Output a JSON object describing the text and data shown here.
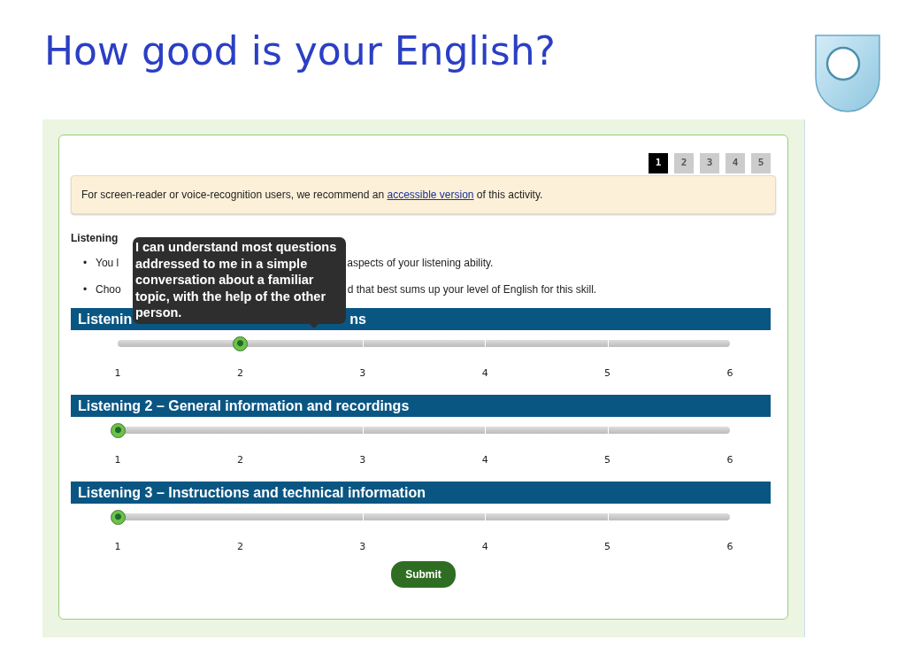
{
  "title": "How good is your English?",
  "pages": [
    {
      "label": "1",
      "selected": true
    },
    {
      "label": "2",
      "selected": false
    },
    {
      "label": "3",
      "selected": false
    },
    {
      "label": "4",
      "selected": false
    },
    {
      "label": "5",
      "selected": false
    }
  ],
  "notice": {
    "before": "For screen-reader or voice-recognition users, we recommend an",
    "link": "accessible version",
    "after": "of this activity."
  },
  "section_title": "Listening",
  "bullets": [
    {
      "marker": "•",
      "parts": [
        "You l",
        "aspects of your listening ability."
      ]
    },
    {
      "marker": "•",
      "parts": [
        "Choo",
        "d that best sums up your level of English for this skill."
      ]
    }
  ],
  "sliders": [
    {
      "heading_parts": [
        "Listenin",
        "ns"
      ],
      "level": 0.2,
      "scale": [
        "1",
        "2",
        "3",
        "4",
        "5",
        "6"
      ]
    },
    {
      "heading_parts": [
        "Listening 2 – General information and recordings"
      ],
      "level": 0,
      "scale": [
        "1",
        "2",
        "3",
        "4",
        "5",
        "6"
      ]
    },
    {
      "heading_parts": [
        "Listening 3 – Instructions and technical information"
      ],
      "level": 0,
      "scale": [
        "1",
        "2",
        "3",
        "4",
        "5",
        "6"
      ]
    }
  ],
  "tooltip": "I can understand most questions addressed to me in a simple conversation about a familiar topic, with the help of the other person.",
  "submit": "Submit"
}
